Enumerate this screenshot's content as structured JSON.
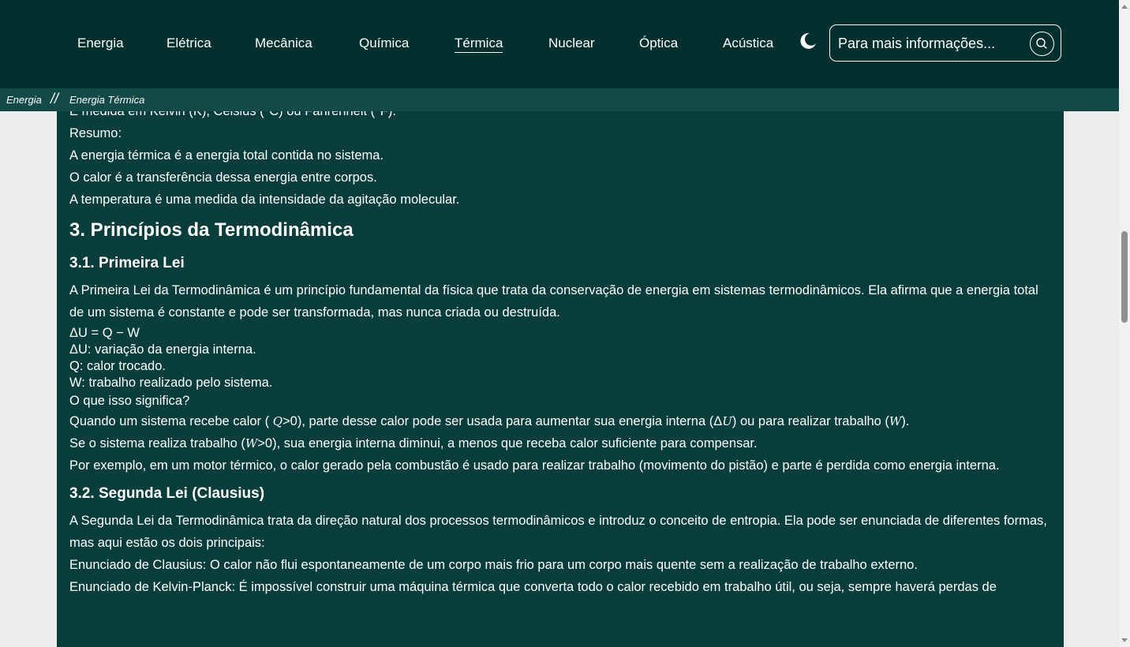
{
  "nav": {
    "items": [
      "Energia",
      "Elétrica",
      "Mecânica",
      "Química",
      "Térmica",
      "Nuclear",
      "Óptica",
      "Acústica"
    ],
    "active": "Térmica"
  },
  "theme_toggle_icon": "moon-icon",
  "search": {
    "placeholder": "Para mais informações...",
    "icon": "search-icon"
  },
  "breadcrumb": {
    "root": "Energia",
    "separator": "//",
    "current": "Energia Térmica"
  },
  "content": {
    "intro_lines": [
      "É medida em Kelvin (K), Celsius (°C) ou Fahrenheit (°F).",
      "Resumo:",
      "A energia térmica é a energia total contida no sistema.",
      "O calor é a transferência dessa energia entre corpos.",
      "A temperatura é uma medida da intensidade da agitação molecular."
    ],
    "section_title": "3. Princípios da Termodinâmica",
    "first_law": {
      "title": "3.1. Primeira Lei",
      "paragraph": "A Primeira Lei da Termodinâmica é um princípio fundamental da física que trata da conservação de energia em sistemas termodinâmicos. Ela afirma que a energia total de um sistema é constante e pode ser transformada, mas nunca criada ou destruída.",
      "equation": "ΔU = Q − W",
      "definitions": [
        "ΔU: variação da energia interna.",
        "Q: calor trocado.",
        "W: trabalho realizado pelo sistema."
      ],
      "question": "O que isso significa?",
      "explanation_1": {
        "p1": "Quando um sistema recebe calor ( ",
        "v1": "Q",
        "p2": ">0), parte desse calor pode ser usada para aumentar sua energia interna (Δ",
        "v2": "U",
        "p3": ") ou para realizar trabalho (",
        "v3": "W",
        "p4": ")."
      },
      "explanation_2": {
        "p1": "Se o sistema realiza trabalho (",
        "v1": "W",
        "p2": ">0), sua energia interna diminui, a menos que receba calor suficiente para compensar."
      },
      "example": "Por exemplo, em um motor térmico, o calor gerado pela combustão é usado para realizar trabalho (movimento do pistão) e parte é perdida como energia interna."
    },
    "second_law": {
      "title": "3.2. Segunda Lei (Clausius)",
      "paragraph": "A Segunda Lei da Termodinâmica trata da direção natural dos processos termodinâmicos e introduz o conceito de entropia. Ela pode ser enunciada de diferentes formas, mas aqui estão os dois principais:",
      "clausius": "Enunciado de Clausius: O calor não flui espontaneamente de um corpo mais frio para um corpo mais quente sem a realização de trabalho externo.",
      "kelvin_planck": "Enunciado de Kelvin-Planck: É impossível construir uma máquina térmica que converta todo o calor recebido em trabalho útil, ou seja, sempre haverá perdas de"
    }
  }
}
